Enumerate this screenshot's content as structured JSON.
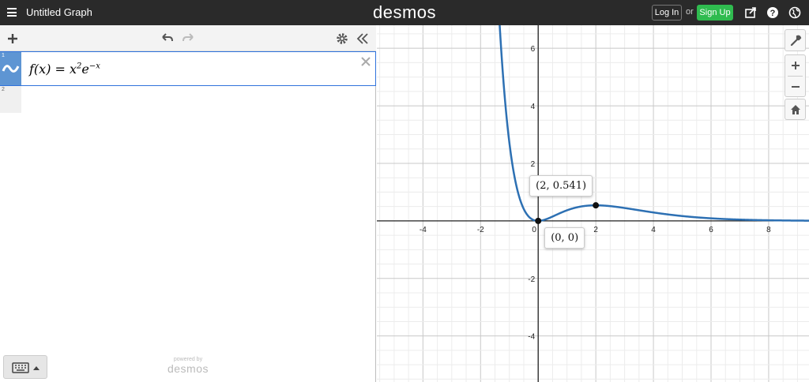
{
  "topbar": {
    "title": "Untitled Graph",
    "brand": "desmos",
    "login_label": "Log In",
    "or_label": "or",
    "signup_label": "Sign Up",
    "signup_color": "#2fbb4f"
  },
  "expressions": [
    {
      "index": "1",
      "latex": "f(x)=x^2e^{-x}"
    },
    {
      "index": "2",
      "latex": ""
    }
  ],
  "footer": {
    "powered_by": "powered by",
    "powered_brand": "desmos"
  },
  "graph": {
    "x_ticks": [
      "-4",
      "-2",
      "0",
      "2",
      "4",
      "6",
      "8"
    ],
    "y_ticks": [
      "6",
      "4",
      "2",
      "-2",
      "-4"
    ],
    "xlim": [
      -5.6,
      9.4
    ],
    "ylim": [
      -5.6,
      6.8
    ],
    "curve_color": "#2d70b3",
    "points": [
      {
        "x": 2,
        "y": 0.541,
        "label": "(2, 0.541)"
      },
      {
        "x": 0,
        "y": 0,
        "label": "(0, 0)"
      }
    ]
  }
}
